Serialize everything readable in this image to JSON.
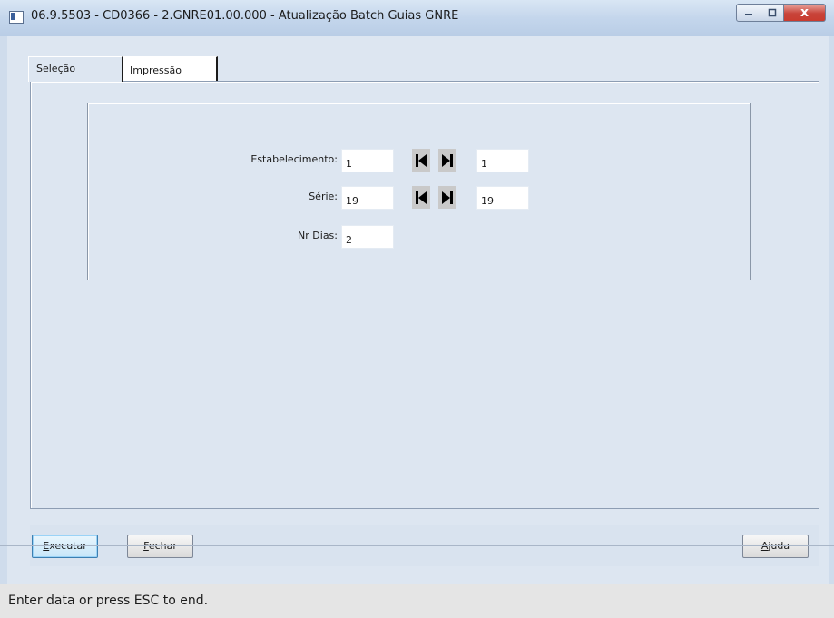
{
  "window": {
    "title": "06.9.5503 - CD0366 - 2.GNRE01.00.000 - Atualização Batch Guias GNRE",
    "controls": {
      "minimize_icon": "minimize-icon",
      "maximize_icon": "maximize-icon",
      "close_icon": "close-icon",
      "close_glyph": "x"
    }
  },
  "tabs": [
    {
      "label": "Seleção",
      "active": true
    },
    {
      "label": "Impressão",
      "active": false
    }
  ],
  "form": {
    "estabelecimento": {
      "label": "Estabelecimento:",
      "from": "1",
      "to": "1"
    },
    "serie": {
      "label": "Série:",
      "from": "19",
      "to": "19"
    },
    "nr_dias": {
      "label": "Nr Dias:",
      "value": "2"
    },
    "nav_icons": {
      "first": "first-record-icon",
      "last": "last-record-icon"
    }
  },
  "buttons": {
    "executar": {
      "first": "E",
      "rest": "xecutar"
    },
    "fechar": {
      "first": "F",
      "rest": "echar"
    },
    "ajuda": {
      "first": "A",
      "rest": "juda"
    }
  },
  "status": {
    "text": "Enter data or press ESC to end."
  },
  "colors": {
    "titlebar": "#c4d6ec",
    "client": "#dde6f1",
    "close_button": "#c8443a",
    "nav_button": "#c9c9c9"
  }
}
